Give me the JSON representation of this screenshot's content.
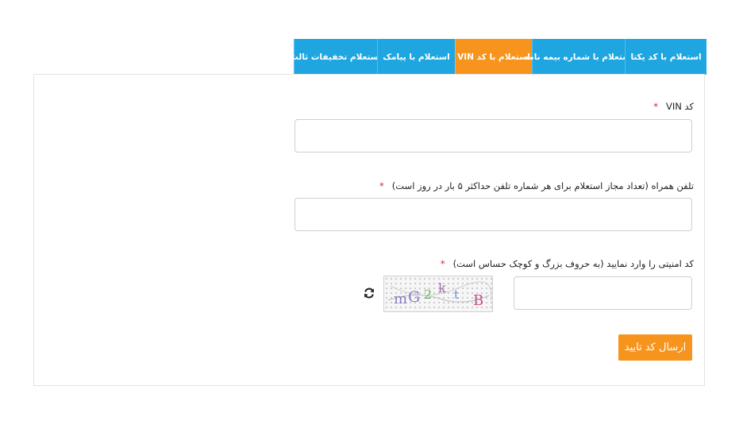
{
  "tabs": [
    {
      "label": "استعلام با کد یکتا",
      "active": false
    },
    {
      "label": "استعلام با شماره بیمه نامه",
      "active": false
    },
    {
      "label": "استعلام با کد VIN",
      "active": true
    },
    {
      "label": "استعلام با پیامک",
      "active": false
    },
    {
      "label": "استعلام تخفیفات ثالث",
      "active": false
    }
  ],
  "form": {
    "vin_label": "کد VIN",
    "vin_value": "",
    "phone_label": "تلفن همراه (تعداد مجاز استعلام برای هر شماره تلفن حداکثر ۵ بار در روز است)",
    "phone_value": "",
    "captcha_label": "کد امنیتی را وارد نمایید (به حروف بزرگ و کوچک حساس است)",
    "captcha_value": "",
    "required_marker": "*",
    "captcha_text": "mG2ktB",
    "refresh_icon": "refresh-icon",
    "submit_label": "ارسال کد تایید"
  },
  "colors": {
    "tab_blue": "#1fa6e0",
    "tab_active": "#f7941d",
    "button": "#f7941d",
    "required": "#d2232a"
  }
}
